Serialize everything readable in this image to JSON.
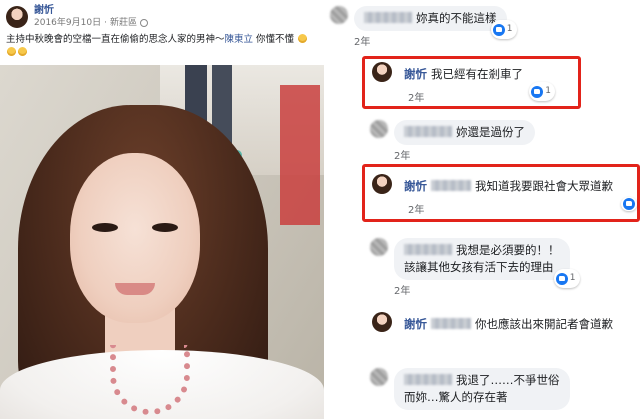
{
  "post": {
    "author": "謝忻",
    "date": "2016年9月10日",
    "location": "新莊區",
    "text_before": "主持中秋晚會的空檔一直在偷偷的思念人家的男神～",
    "mention": "陳東立",
    "text_after": " 你懂不懂"
  },
  "comments": [
    {
      "name": "",
      "text": "妳真的不能這樣",
      "time": "2年",
      "likes": "1"
    },
    {
      "name": "謝忻",
      "text": "我已經有在剎車了",
      "time": "2年",
      "likes": "1"
    },
    {
      "name": "",
      "text": "妳還是過份了",
      "time": "2年",
      "likes": ""
    },
    {
      "name": "謝忻",
      "text": "我知道我要跟社會大眾道歉",
      "time": "2年",
      "likes": ""
    },
    {
      "name": "",
      "text": "我想是必須要的！！",
      "text2": "該讓其他女孩有活下去的理由",
      "time": "2年",
      "likes": "1"
    },
    {
      "name": "謝忻",
      "text": "你也應該出來開記者會道歉",
      "time": "",
      "likes": ""
    },
    {
      "name": "",
      "text": "我退了……不爭世俗",
      "text2": "而妳…驚人的存在著",
      "time": "",
      "likes": ""
    }
  ],
  "colors": {
    "highlight": "#e2231a",
    "link": "#385898",
    "like": "#1877f2",
    "bubble": "#f0f2f5"
  },
  "icons": [
    "globe-icon",
    "emoji-icon",
    "like-icon"
  ]
}
